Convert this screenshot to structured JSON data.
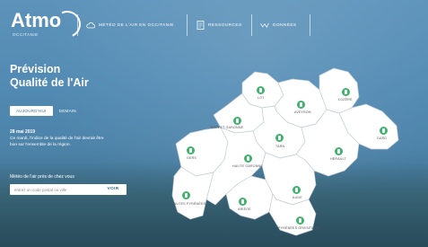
{
  "brand": {
    "name": "Atmo",
    "subtitle": "OCCITANIE"
  },
  "nav": [
    {
      "label": "MÉTÉO DE L'AIR EN OCCITANIE",
      "icon": "cloud-icon"
    },
    {
      "label": "RESSOURCES",
      "icon": "document-icon"
    },
    {
      "label": "DONNÉES",
      "icon": "chart-icon"
    }
  ],
  "title": {
    "line1": "Prévision",
    "line2": "Qualité de l'Air"
  },
  "tabs": {
    "today": "AUJOURD'HUI",
    "tomorrow": "DEMAIN"
  },
  "forecast": {
    "date": "28 mai 2019",
    "text": "Ce mardi, l'indice de la qualité de l'air devrait être bon sur l'ensemble de la région."
  },
  "search": {
    "label": "Météo de l'air près de chez vous",
    "placeholder": "entrez un code postal ou ville",
    "button": "VOIR"
  },
  "departments": [
    {
      "id": "lot",
      "label": "LOT"
    },
    {
      "id": "aveyron",
      "label": "AVEYRON"
    },
    {
      "id": "lozere",
      "label": "LOZÈRE"
    },
    {
      "id": "gard",
      "label": "GARD"
    },
    {
      "id": "tarn-et-garonne",
      "label": "TARN ET GARONNE"
    },
    {
      "id": "tarn",
      "label": "TARN"
    },
    {
      "id": "herault",
      "label": "HÉRAULT"
    },
    {
      "id": "gers",
      "label": "GERS"
    },
    {
      "id": "haute-garonne",
      "label": "HAUTE GARONNE"
    },
    {
      "id": "hautes-pyrenees",
      "label": "HAUTES PYRÉNÉES"
    },
    {
      "id": "ariege",
      "label": "ARIÈGE"
    },
    {
      "id": "aude",
      "label": "AUDE"
    },
    {
      "id": "pyrenees-orientales",
      "label": "PYRÉNÉES ORIENTALES"
    }
  ],
  "colors": {
    "good": "#3fb36b",
    "map_fill": "#ffffff",
    "map_border": "#c9d3dc"
  }
}
